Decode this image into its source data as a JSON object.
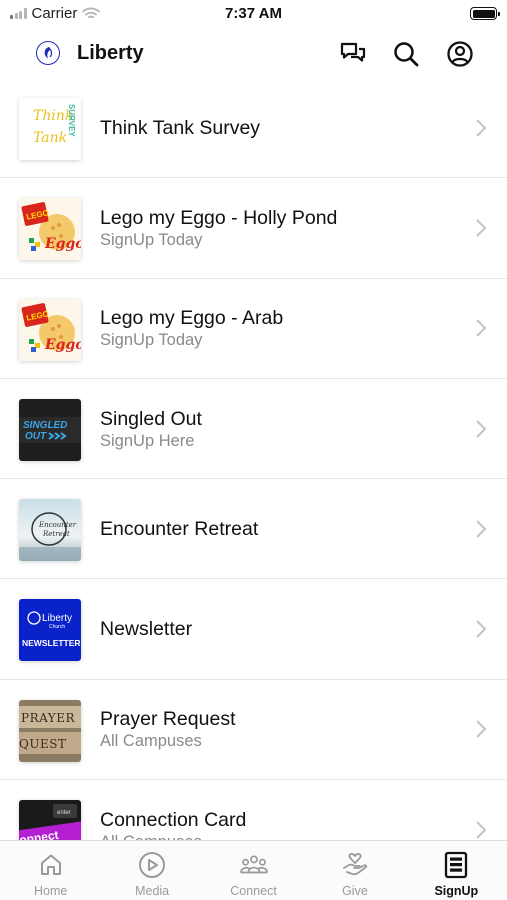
{
  "status_bar": {
    "carrier": "Carrier",
    "time": "7:37 AM"
  },
  "nav": {
    "title": "Liberty",
    "icons": [
      "chat-icon",
      "search-icon",
      "profile-icon"
    ]
  },
  "items": [
    {
      "title": "Think Tank Survey",
      "subtitle": "",
      "thumb": "think-tank-survey",
      "thumb_text": [
        "Think",
        "Tank",
        "SURVEY"
      ]
    },
    {
      "title": "Lego my Eggo - Holly Pond",
      "subtitle": "SignUp Today",
      "thumb": "lego-my-eggo",
      "thumb_text": [
        "LEGO",
        "Eggo"
      ]
    },
    {
      "title": "Lego my Eggo - Arab",
      "subtitle": "SignUp Today",
      "thumb": "lego-my-eggo",
      "thumb_text": [
        "LEGO",
        "Eggo"
      ]
    },
    {
      "title": "Singled Out",
      "subtitle": "SignUp Here",
      "thumb": "singled-out",
      "thumb_text": [
        "SINGLED",
        "OUT"
      ]
    },
    {
      "title": "Encounter Retreat",
      "subtitle": "",
      "thumb": "encounter-retreat",
      "thumb_text": [
        "Encounter",
        "Retreat"
      ]
    },
    {
      "title": "Newsletter",
      "subtitle": "",
      "thumb": "newsletter",
      "thumb_text": [
        "Liberty",
        "Church",
        "NEWSLETTER"
      ]
    },
    {
      "title": "Prayer Request",
      "subtitle": "All Campuses",
      "thumb": "prayer-request",
      "thumb_text": [
        "PRAYER",
        "QUEST"
      ]
    },
    {
      "title": "Connection Card",
      "subtitle": "All Campuses",
      "thumb": "connection-card",
      "thumb_text": [
        "enter",
        "onnect"
      ]
    }
  ],
  "tabs": [
    {
      "label": "Home",
      "icon": "home-icon",
      "active": false
    },
    {
      "label": "Media",
      "icon": "play-icon",
      "active": false
    },
    {
      "label": "Connect",
      "icon": "people-icon",
      "active": false
    },
    {
      "label": "Give",
      "icon": "give-hand-icon",
      "active": false
    },
    {
      "label": "SignUp",
      "icon": "signup-form-icon",
      "active": true
    }
  ],
  "colors": {
    "accent": "#111111",
    "inactive_tab": "#9a9a9a",
    "subtitle": "#8a8a8a",
    "brand_blue": "#1d2bb8",
    "newsletter_blue": "#0a22c9"
  }
}
